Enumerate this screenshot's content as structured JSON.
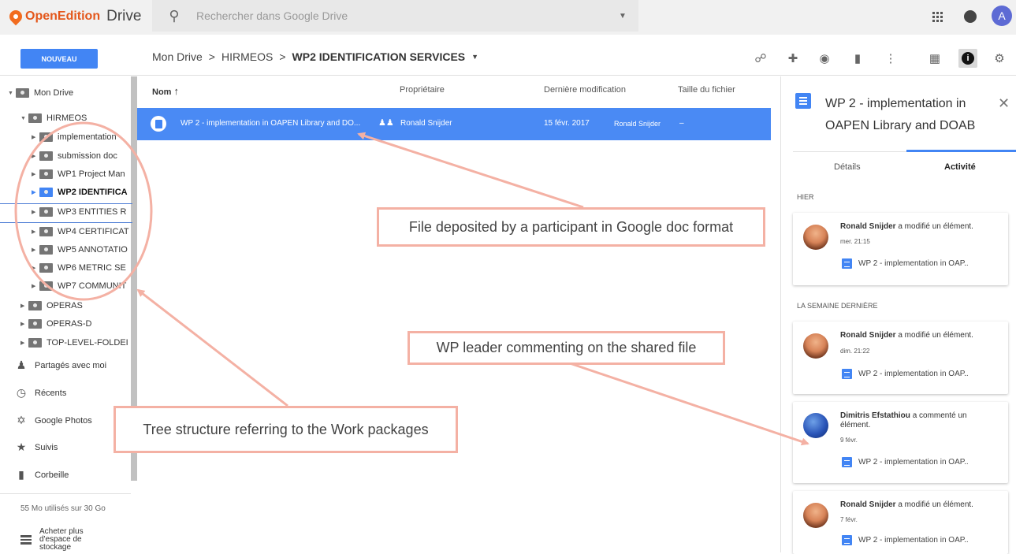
{
  "app": {
    "brand": "OpenEdition",
    "product": "Drive",
    "avatar_letter": "A",
    "accent": "#4285f4",
    "brand_color": "#e4571b"
  },
  "search": {
    "placeholder": "Rechercher dans Google Drive"
  },
  "toolbar": {
    "new_label": "NOUVEAU",
    "breadcrumb": [
      "Mon Drive",
      "HIRMEOS",
      "WP2 IDENTIFICATION SERVICES"
    ],
    "separator": ">",
    "icons": [
      "link-icon",
      "add-person-icon",
      "eye-icon",
      "trash-icon",
      "more-icon",
      "grid-view-icon",
      "info-icon",
      "settings-icon"
    ]
  },
  "sidebar": {
    "root": "Mon Drive",
    "tree": [
      {
        "label": "HIRMEOS"
      },
      {
        "label": "implementation"
      },
      {
        "label": "submission doc"
      },
      {
        "label": "WP1 Project Man"
      },
      {
        "label": "WP2 IDENTIFICA"
      },
      {
        "label": "WP3 ENTITIES R"
      },
      {
        "label": "WP4 CERTIFICAT"
      },
      {
        "label": "WP5 ANNOTATIO"
      },
      {
        "label": "WP6 METRIC SE"
      },
      {
        "label": "WP7 COMMUNIT"
      },
      {
        "label": "OPERAS"
      },
      {
        "label": "OPERAS-D"
      },
      {
        "label": "TOP-LEVEL-FOLDEI"
      }
    ],
    "nav": [
      {
        "label": "Partagés avec moi",
        "icon": "people-icon"
      },
      {
        "label": "Récents",
        "icon": "clock-icon"
      },
      {
        "label": "Google Photos",
        "icon": "pinwheel-icon"
      },
      {
        "label": "Suivis",
        "icon": "star-icon"
      },
      {
        "label": "Corbeille",
        "icon": "trash-icon"
      }
    ],
    "quota": "55 Mo utilisés sur 30 Go",
    "buy": [
      "Acheter plus",
      "d'espace de",
      "stockage"
    ]
  },
  "list": {
    "columns": [
      "Nom",
      "Propriétaire",
      "Dernière modification",
      "Taille du fichier"
    ],
    "sort_arrow": "↑",
    "rows": [
      {
        "name": "WP 2 - implementation in OAPEN Library and DO...",
        "owner": "Ronald Snijder",
        "modified": "15 févr. 2017",
        "modified_by": "Ronald Snijder",
        "size": "–"
      }
    ]
  },
  "details": {
    "title": "WP 2 - implementation in OAPEN Library and DOAB",
    "tabs": [
      "Détails",
      "Activité"
    ],
    "sections": [
      "HIER",
      "LA SEMAINE DERNIÈRE"
    ],
    "activities": [
      {
        "user": "Ronald Snijder",
        "action": "a modifié un élément.",
        "when": "mer. 21:15",
        "file": "WP 2 - implementation in OAP.."
      },
      {
        "user": "Ronald Snijder",
        "action": "a modifié un élément.",
        "when": "dim. 21:22",
        "file": "WP 2 - implementation in OAP.."
      },
      {
        "user": "Dimitris Efstathiou",
        "action": "a commenté un élément.",
        "when": "9 févr.",
        "file": "WP 2 - implementation in OAP.."
      },
      {
        "user": "Ronald Snijder",
        "action": "a modifié un élément.",
        "when": "7 févr.",
        "file": "WP 2 - implementation in OAP.."
      }
    ]
  },
  "annotations": {
    "file_note": "File deposited by a participant in Google doc format",
    "comment_note": "WP leader commenting on the shared file",
    "tree_note": "Tree structure referring to the Work packages",
    "color": "#f4b1a4"
  }
}
